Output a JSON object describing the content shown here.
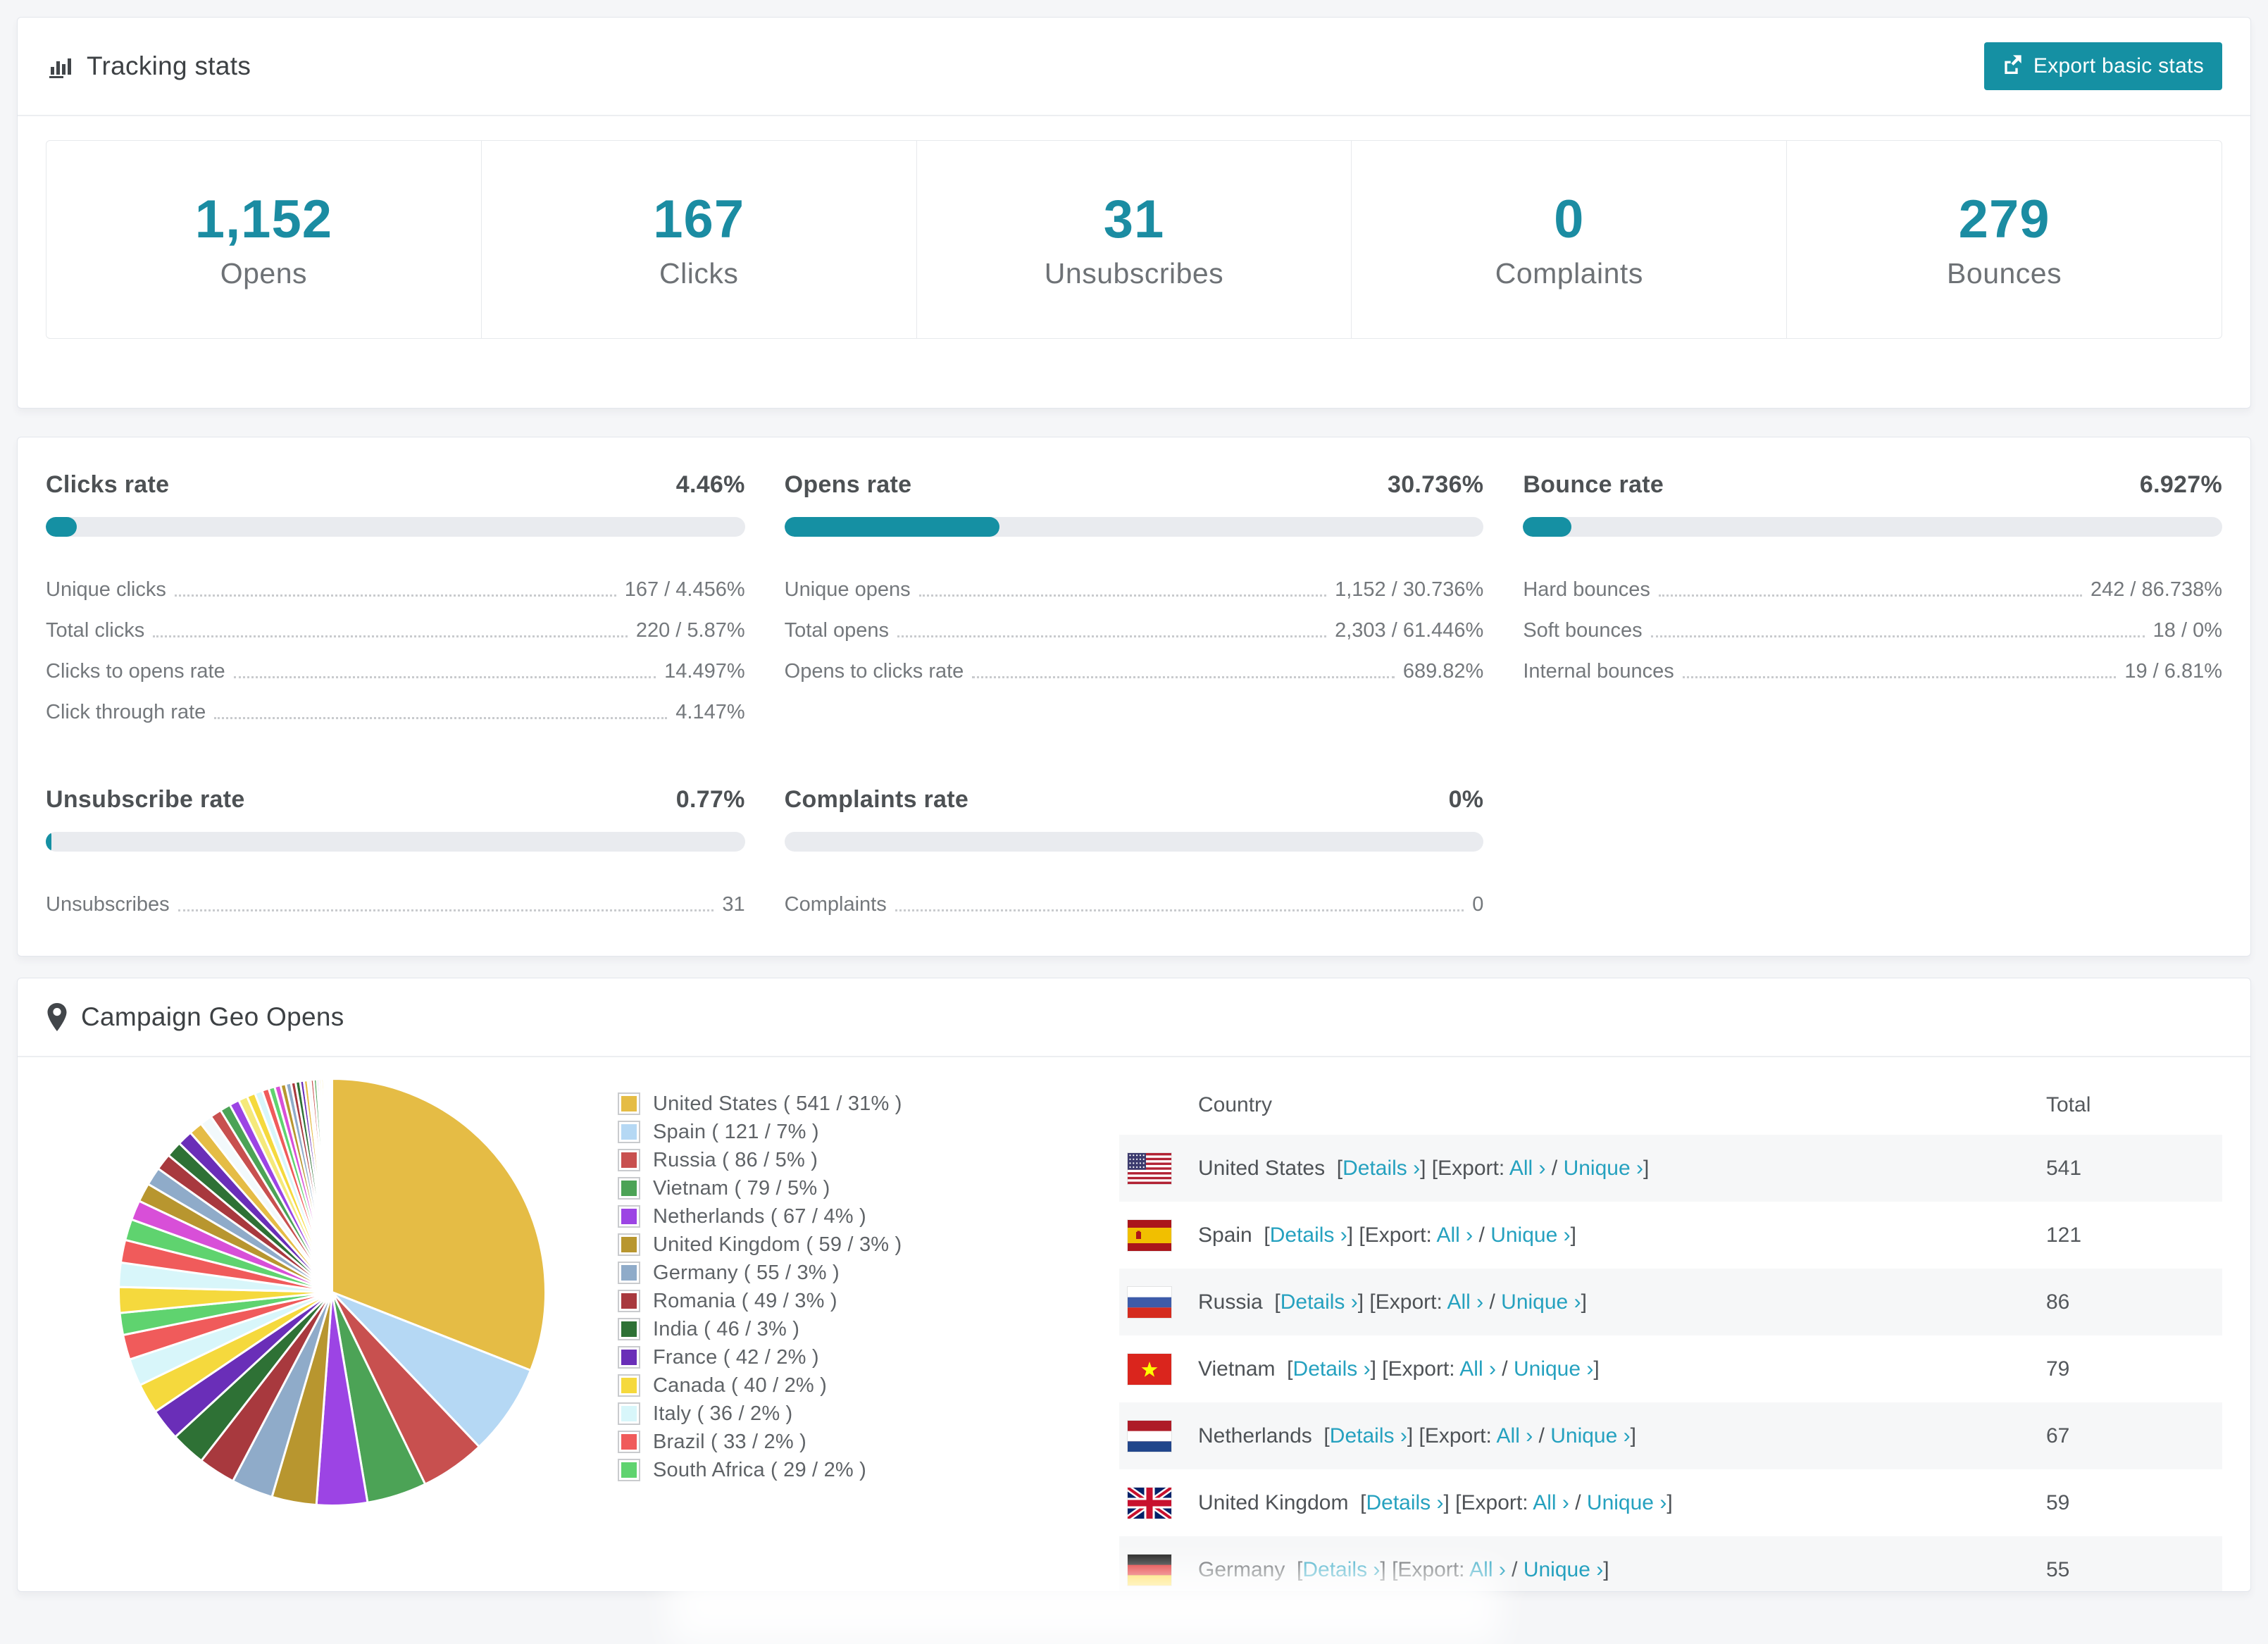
{
  "colors": {
    "accent": "#1B8CA2",
    "button_bg": "#1590A3",
    "link": "#25A1BF",
    "page_bg": "#F5F6F8",
    "progress_track": "#E9EBEF"
  },
  "tracking": {
    "title": "Tracking stats",
    "export_label": "Export basic stats",
    "stats": [
      {
        "value": "1,152",
        "label": "Opens"
      },
      {
        "value": "167",
        "label": "Clicks"
      },
      {
        "value": "31",
        "label": "Unsubscribes"
      },
      {
        "value": "0",
        "label": "Complaints"
      },
      {
        "value": "279",
        "label": "Bounces"
      }
    ]
  },
  "rates": [
    {
      "title": "Clicks rate",
      "value": "4.46%",
      "percent": 4.46,
      "rows": [
        {
          "label": "Unique clicks",
          "value": "167 / 4.456%"
        },
        {
          "label": "Total clicks",
          "value": "220 / 5.87%"
        },
        {
          "label": "Clicks to opens rate",
          "value": "14.497%"
        },
        {
          "label": "Click through rate",
          "value": "4.147%"
        }
      ]
    },
    {
      "title": "Opens rate",
      "value": "30.736%",
      "percent": 30.736,
      "rows": [
        {
          "label": "Unique opens",
          "value": "1,152 / 30.736%"
        },
        {
          "label": "Total opens",
          "value": "2,303 / 61.446%"
        },
        {
          "label": "Opens to clicks rate",
          "value": "689.82%"
        }
      ]
    },
    {
      "title": "Bounce rate",
      "value": "6.927%",
      "percent": 6.927,
      "rows": [
        {
          "label": "Hard bounces",
          "value": "242 / 86.738%"
        },
        {
          "label": "Soft bounces",
          "value": "18 / 0%"
        },
        {
          "label": "Internal bounces",
          "value": "19 / 6.81%"
        }
      ]
    },
    {
      "title": "Unsubscribe rate",
      "value": "0.77%",
      "percent": 0.77,
      "rows": [
        {
          "label": "Unsubscribes",
          "value": "31"
        }
      ]
    },
    {
      "title": "Complaints rate",
      "value": "0%",
      "percent": 0,
      "rows": [
        {
          "label": "Complaints",
          "value": "0"
        }
      ]
    }
  ],
  "geo": {
    "title": "Campaign Geo Opens",
    "table": {
      "headers": [
        "Country",
        "Total"
      ],
      "link_labels": {
        "details": "Details ›",
        "export": "Export:",
        "all": "All ›",
        "unique": "Unique ›"
      },
      "rows": [
        {
          "country": "United States",
          "flag": "us",
          "total": "541"
        },
        {
          "country": "Spain",
          "flag": "es",
          "total": "121"
        },
        {
          "country": "Russia",
          "flag": "ru",
          "total": "86"
        },
        {
          "country": "Vietnam",
          "flag": "vn",
          "total": "79"
        },
        {
          "country": "Netherlands",
          "flag": "nl",
          "total": "67"
        },
        {
          "country": "United Kingdom",
          "flag": "gb",
          "total": "59"
        },
        {
          "country": "Germany",
          "flag": "de",
          "total": "55"
        }
      ]
    }
  },
  "chart_data": {
    "type": "pie",
    "title": "Campaign Geo Opens",
    "legend_position": "right",
    "start_angle_deg": -90,
    "direction": "clockwise",
    "slices": [
      {
        "label": "United States",
        "value": 541,
        "pct": "31%",
        "color": "#E5BC45"
      },
      {
        "label": "Spain",
        "value": 121,
        "pct": "7%",
        "color": "#B5D8F4"
      },
      {
        "label": "Russia",
        "value": 86,
        "pct": "5%",
        "color": "#C8504F"
      },
      {
        "label": "Vietnam",
        "value": 79,
        "pct": "5%",
        "color": "#4CA356"
      },
      {
        "label": "Netherlands",
        "value": 67,
        "pct": "4%",
        "color": "#9C44E4"
      },
      {
        "label": "United Kingdom",
        "value": 59,
        "pct": "3%",
        "color": "#B8962F"
      },
      {
        "label": "Germany",
        "value": 55,
        "pct": "3%",
        "color": "#8FABC9"
      },
      {
        "label": "Romania",
        "value": 49,
        "pct": "3%",
        "color": "#A8393E"
      },
      {
        "label": "India",
        "value": 46,
        "pct": "3%",
        "color": "#2E7135"
      },
      {
        "label": "France",
        "value": 42,
        "pct": "2%",
        "color": "#6A2EB8"
      },
      {
        "label": "Canada",
        "value": 40,
        "pct": "2%",
        "color": "#F5D93D"
      },
      {
        "label": "Italy",
        "value": 36,
        "pct": "2%",
        "color": "#D8F6FA"
      },
      {
        "label": "Brazil",
        "value": 33,
        "pct": "2%",
        "color": "#F05B5B"
      },
      {
        "label": "South Africa",
        "value": 29,
        "pct": "2%",
        "color": "#5FD36F"
      }
    ],
    "others": {
      "description": "unlabeled minor-country slices, values estimated from pie",
      "values": [
        34,
        32,
        30,
        28,
        26,
        25,
        24,
        22,
        21,
        20,
        18,
        16,
        15,
        14,
        13,
        12,
        11,
        10,
        9,
        8,
        8,
        7,
        7,
        6,
        6,
        5,
        5,
        4,
        4,
        4,
        3,
        3,
        3,
        2,
        2,
        2,
        2,
        1,
        1,
        1
      ],
      "palette": [
        "#F5D93D",
        "#D8F6FA",
        "#F05B5B",
        "#5FD36F",
        "#D84FD8",
        "#B8962F",
        "#8FABC9",
        "#A8393E",
        "#2E7135",
        "#6A2EB8",
        "#E5BC45",
        "#F2F9FB",
        "#C8504F",
        "#4CA356",
        "#9C44E4",
        "#F5E97B"
      ]
    }
  }
}
